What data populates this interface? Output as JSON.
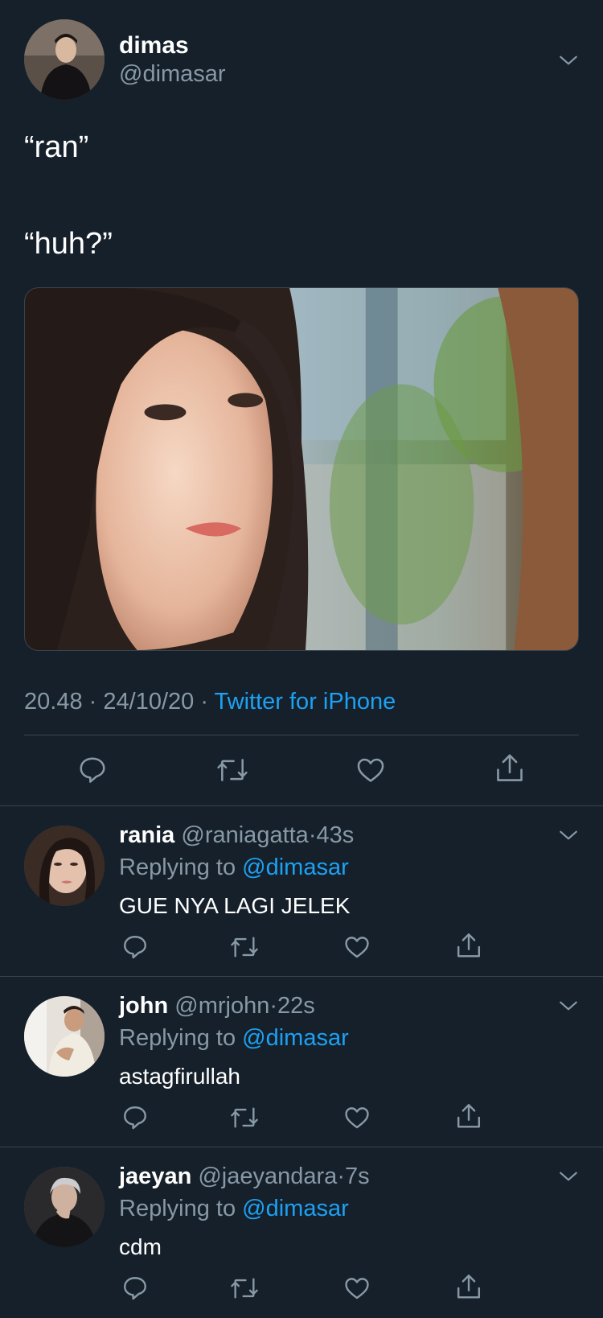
{
  "main_tweet": {
    "author_name": "dimas",
    "author_handle": "@dimasar",
    "text_line1": "“ran”",
    "text_line2": "“huh?”",
    "time": "20.48",
    "date": "24/10/20",
    "source": "Twitter for iPhone",
    "separator": "·"
  },
  "replies": [
    {
      "name": "rania",
      "handle": "@raniagatta",
      "time": "43s",
      "replying_prefix": "Replying to",
      "replying_to": "@dimasar",
      "text": "GUE NYA LAGI JELEK",
      "separator": "·"
    },
    {
      "name": "john",
      "handle": "@mrjohn",
      "time": "22s",
      "replying_prefix": "Replying to",
      "replying_to": "@dimasar",
      "text": "astagfirullah",
      "separator": "·"
    },
    {
      "name": "jaeyan",
      "handle": "@jaeyandara",
      "time": "7s",
      "replying_prefix": "Replying to",
      "replying_to": "@dimasar",
      "text": "cdm",
      "separator": "·"
    }
  ],
  "icons": {
    "reply": "reply-icon",
    "retweet": "retweet-icon",
    "like": "heart-icon",
    "share": "share-icon",
    "menu": "chevron-down-icon"
  },
  "colors": {
    "background": "#15202b",
    "accent": "#1da1f2",
    "muted": "#8899a6",
    "divider": "#38444d"
  }
}
